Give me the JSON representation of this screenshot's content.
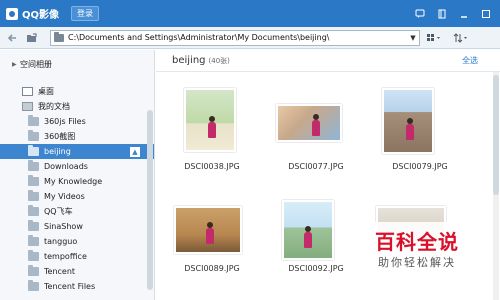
{
  "app": {
    "title": "QQ影像",
    "login_label": "登录"
  },
  "toolbar": {
    "path": "C:\\Documents and Settings\\Administrator\\My Documents\\beijing\\"
  },
  "sidebar": {
    "group_label": "空间相册",
    "desktop_label": "桌面",
    "documents_label": "我的文档",
    "items": [
      {
        "label": "360js Files"
      },
      {
        "label": "360截图"
      },
      {
        "label": "beijing",
        "selected": true
      },
      {
        "label": "Downloads"
      },
      {
        "label": "My Knowledge"
      },
      {
        "label": "My Videos"
      },
      {
        "label": "QQ飞车"
      },
      {
        "label": "SinaShow"
      },
      {
        "label": "tangguo"
      },
      {
        "label": "tempoffice"
      },
      {
        "label": "Tencent"
      },
      {
        "label": "Tencent Files"
      }
    ]
  },
  "main": {
    "folder_name": "beijing",
    "count_label": "(40张)",
    "select_all_label": "全选",
    "photos": [
      {
        "filename": "DSCI0038.JPG"
      },
      {
        "filename": "DSCI0077.JPG"
      },
      {
        "filename": "DSCI0079.JPG"
      },
      {
        "filename": "DSCI0089.JPG"
      },
      {
        "filename": "DSCI0092.JPG"
      },
      {
        "filename": ""
      }
    ]
  },
  "watermark": {
    "logo": "百科全说",
    "subtitle": "助你轻松解决"
  },
  "colors": {
    "titlebar": "#2b79c6",
    "selection": "#3d86cf",
    "link": "#2b79c6",
    "watermark_red": "#d9102a"
  }
}
